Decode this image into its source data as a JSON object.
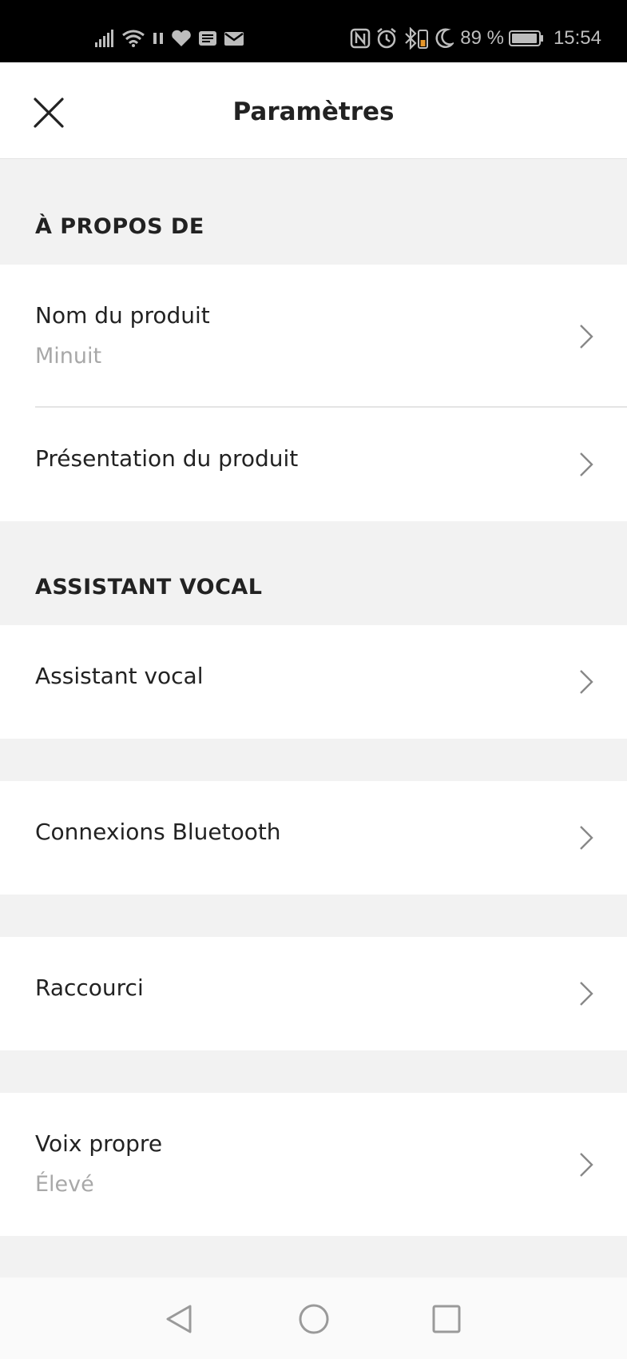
{
  "status_bar": {
    "battery_percent": "89 %",
    "time": "15:54",
    "icons_left": [
      "signal-icon",
      "wifi-icon",
      "pause-icon",
      "heart-icon",
      "news-icon",
      "mail-icon"
    ],
    "icons_right": [
      "nfc-icon",
      "alarm-icon",
      "bluetooth-battery-icon",
      "moon-icon",
      "battery-icon"
    ]
  },
  "header": {
    "title": "Paramètres",
    "close_icon": "close-icon"
  },
  "sections": {
    "about": {
      "heading": "À PROPOS DE",
      "product_name": {
        "label": "Nom du produit",
        "value": "Minuit"
      },
      "product_overview": {
        "label": "Présentation du produit"
      }
    },
    "voice_assistant": {
      "heading": "ASSISTANT VOCAL",
      "item": {
        "label": "Assistant vocal"
      }
    },
    "bluetooth": {
      "label": "Connexions Bluetooth"
    },
    "shortcut": {
      "label": "Raccourci"
    },
    "self_voice": {
      "label": "Voix propre",
      "value": "Élevé"
    }
  },
  "nav_bar": {
    "icons": [
      "back-triangle-icon",
      "home-circle-icon",
      "recents-square-icon"
    ]
  },
  "colors": {
    "background": "#f2f2f2",
    "surface": "#ffffff",
    "text_primary": "#222222",
    "text_secondary": "#a8a8a8",
    "chevron": "#888888"
  }
}
